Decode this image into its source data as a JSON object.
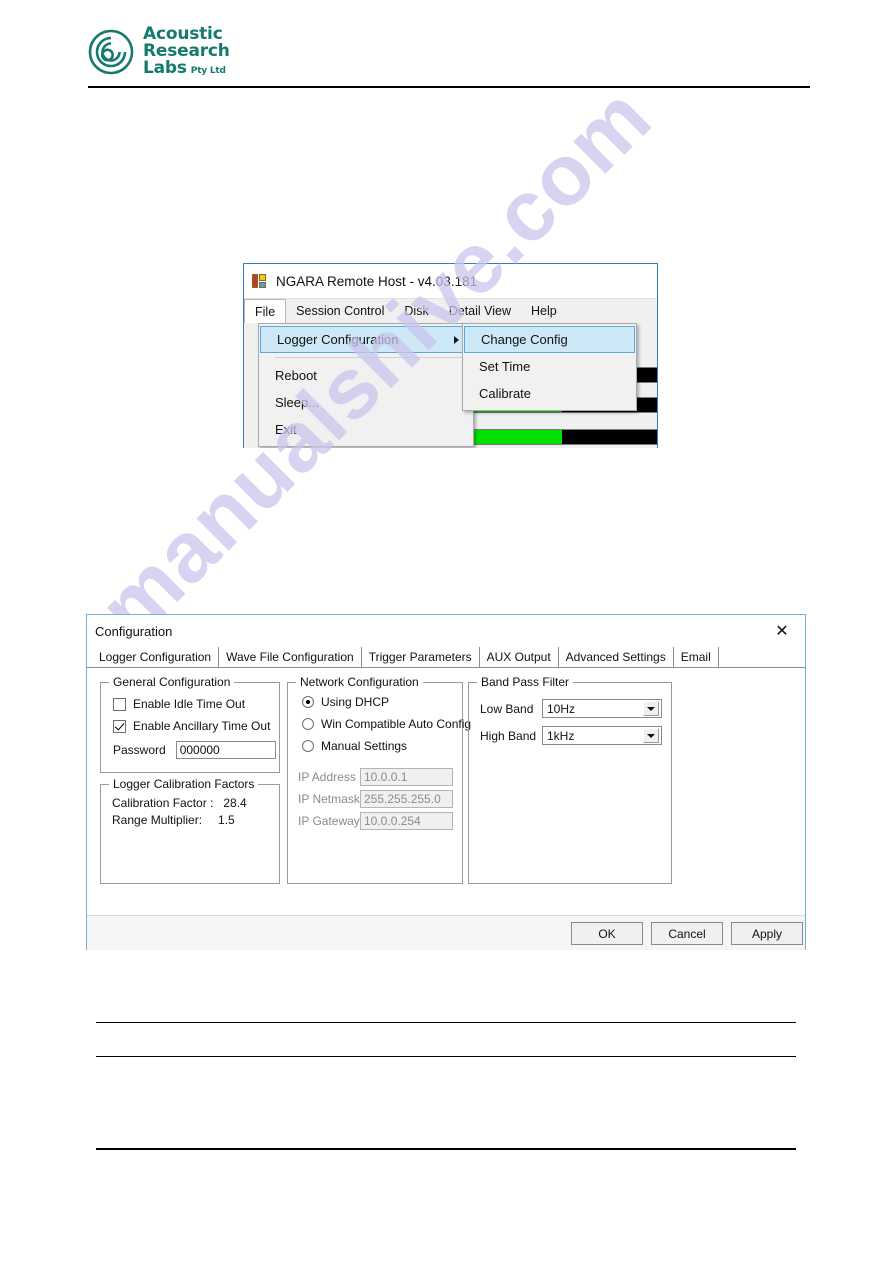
{
  "brand": {
    "logo_icon": "spiral-circles-icon",
    "line1": "Acoustic",
    "line2": "Research",
    "line3": "Labs",
    "line3_suffix": "Pty Ltd",
    "color": "#157a6e"
  },
  "watermark": {
    "text": "manualshive.com",
    "color": "#c9c6ec"
  },
  "app_window": {
    "icon": "dotnet-app-icon",
    "title": "NGARA Remote Host - v4.03.181",
    "menubar": [
      {
        "label": "File",
        "active": true
      },
      {
        "label": "Session Control",
        "active": false
      },
      {
        "label": "Disk",
        "active": false
      },
      {
        "label": "Detail View",
        "active": false
      },
      {
        "label": "Help",
        "active": false
      }
    ],
    "file_menu": [
      {
        "label": "Logger Configuration",
        "highlight": true,
        "submenu_arrow": true
      },
      {
        "label": "Reboot",
        "highlight": false,
        "submenu_arrow": false
      },
      {
        "label": "Sleep...",
        "highlight": false,
        "submenu_arrow": false
      },
      {
        "label": "Exit",
        "highlight": false,
        "submenu_arrow": false
      }
    ],
    "sub_menu": [
      {
        "label": "Change Config",
        "highlight": true
      },
      {
        "label": "Set Time",
        "highlight": false
      },
      {
        "label": "Calibrate",
        "highlight": false
      }
    ],
    "background": {
      "progress_color": "#00e000",
      "progress_track_color": "#000000"
    }
  },
  "dialog": {
    "title": "Configuration",
    "close_icon": "close-icon",
    "tabs": [
      {
        "label": "Logger Configuration",
        "selected": true
      },
      {
        "label": "Wave File Configuration",
        "selected": false
      },
      {
        "label": "Trigger Parameters",
        "selected": false
      },
      {
        "label": "AUX Output",
        "selected": false
      },
      {
        "label": "Advanced Settings",
        "selected": false
      },
      {
        "label": "Email",
        "selected": false
      }
    ],
    "general": {
      "legend": "General Configuration",
      "idle_timeout_label": "Enable Idle Time Out",
      "idle_timeout_checked": false,
      "ancillary_timeout_label": "Enable Ancillary Time Out",
      "ancillary_timeout_checked": true,
      "password_label": "Password",
      "password_value": "000000"
    },
    "calibration": {
      "legend": "Logger Calibration Factors",
      "calibration_factor_label": "Calibration Factor :",
      "calibration_factor_value": "28.4",
      "range_multiplier_label": "Range Multiplier:",
      "range_multiplier_value": "1.5"
    },
    "network": {
      "legend": "Network Configuration",
      "option_dhcp": "Using DHCP",
      "option_win_auto": "Win Compatible Auto Config",
      "option_manual": "Manual Settings",
      "selected_option": "Using DHCP",
      "ip_address_label": "IP Address",
      "ip_address_value": "10.0.0.1",
      "ip_netmask_label": "IP Netmask",
      "ip_netmask_value": "255.255.255.0",
      "ip_gateway_label": "IP Gateway",
      "ip_gateway_value": "10.0.0.254"
    },
    "bandpass": {
      "legend": "Band Pass Filter",
      "low_band_label": "Low Band",
      "low_band_value": "10Hz",
      "high_band_label": "High Band",
      "high_band_value": "1kHz",
      "dropdown_icon": "chevron-down-icon"
    },
    "buttons": {
      "ok": "OK",
      "cancel": "Cancel",
      "apply": "Apply"
    }
  }
}
